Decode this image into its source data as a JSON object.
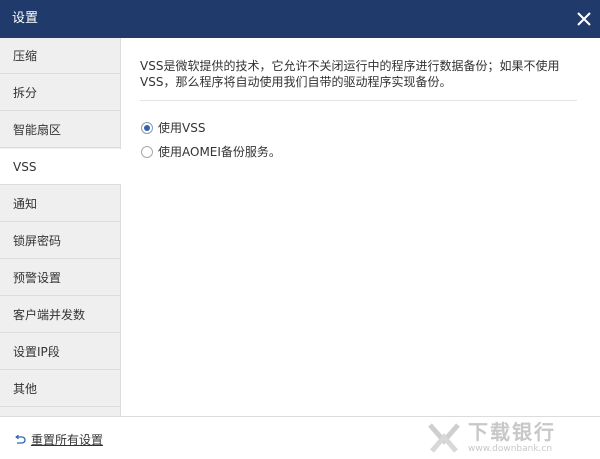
{
  "window": {
    "title": "设置",
    "close_icon": "close-icon"
  },
  "sidebar": {
    "items": [
      {
        "label": "压缩",
        "active": false
      },
      {
        "label": "拆分",
        "active": false
      },
      {
        "label": "智能扇区",
        "active": false
      },
      {
        "label": "VSS",
        "active": true
      },
      {
        "label": "通知",
        "active": false
      },
      {
        "label": "锁屏密码",
        "active": false
      },
      {
        "label": "预警设置",
        "active": false
      },
      {
        "label": "客户端并发数",
        "active": false
      },
      {
        "label": "设置IP段",
        "active": false
      },
      {
        "label": "其他",
        "active": false
      }
    ]
  },
  "content": {
    "description": "VSS是微软提供的技术，它允许不关闭运行中的程序进行数据备份；如果不使用VSS，那么程序将自动使用我们自带的驱动程序实现备份。",
    "options": [
      {
        "label": "使用VSS",
        "selected": true
      },
      {
        "label": "使用AOMEI备份服务。",
        "selected": false
      }
    ]
  },
  "footer": {
    "reset_label": "重置所有设置",
    "reset_icon": "undo-icon"
  },
  "watermark": {
    "brand": "下载银行",
    "site": "www.downbank.cn"
  },
  "colors": {
    "titlebar": "#1f3a6b",
    "sidebar_bg": "#efefef",
    "active_bg": "#ffffff",
    "radio_accent": "#2f63b4"
  }
}
